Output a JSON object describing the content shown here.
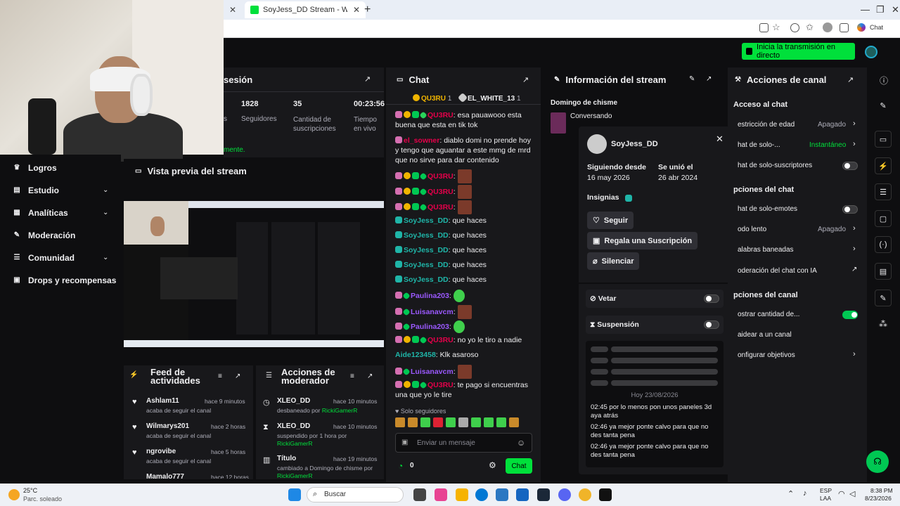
{
  "browser": {
    "tab1_label": "SoyJess_DD Stream - Watch Live o",
    "chat_label": "Chat"
  },
  "header": {
    "go_live": "Inicia la transmisión en directo"
  },
  "session": {
    "title": "sesión",
    "stats": [
      {
        "value": "",
        "label": "s"
      },
      {
        "value": "1828",
        "label": "Seguidores"
      },
      {
        "value": "35",
        "label": "Cantidad de suscripciones"
      },
      {
        "value": "00:23:56",
        "label": "Tiempo en vivo"
      }
    ],
    "footer": "mente."
  },
  "nav": {
    "items": [
      {
        "label": "Logros"
      },
      {
        "label": "Estudio"
      },
      {
        "label": "Analíticas"
      },
      {
        "label": "Moderación"
      },
      {
        "label": "Comunidad"
      },
      {
        "label": "Drops y recompensas"
      }
    ]
  },
  "preview": {
    "title": "Vista previa del stream"
  },
  "feed": {
    "title": "Feed de actividades",
    "items": [
      {
        "name": "Ashlam11",
        "time": "hace 9 minutos",
        "desc": "acaba de seguir el canal"
      },
      {
        "name": "Wilmarys201",
        "time": "hace 2 horas",
        "desc": "acaba de seguir el canal"
      },
      {
        "name": "ngrovibe",
        "time": "hace 5 horas",
        "desc": "acaba de seguir el canal"
      },
      {
        "name": "Mamalo777",
        "time": "hace 12 horas",
        "desc": ""
      }
    ]
  },
  "mod": {
    "title": "Acciones de moderador",
    "items": [
      {
        "name": "XLEO_DD",
        "time": "hace 10 minutos",
        "desc": "desbaneado por",
        "by": "RickiGamerR"
      },
      {
        "name": "XLEO_DD",
        "time": "hace 10 minutos",
        "desc": "suspendido por 1 hora por",
        "by": "RickiGamerR"
      },
      {
        "name": "Título",
        "time": "hace 19 minutos",
        "desc": "cambiado a Domingo de chisme por",
        "by": "RickiGamerR"
      }
    ]
  },
  "chat": {
    "title": "Chat",
    "leaders": [
      {
        "name": "QU3RU",
        "count": "1"
      },
      {
        "name": "EL_WHITE_13",
        "count": "1"
      }
    ],
    "messages": [
      {
        "user": "QU3RU",
        "text": ": esa pauawooo esta buena que esta en tik tok"
      },
      {
        "user": "el_sowner",
        "text": ": diablo domi no prende hoy y tengo que aguantar a este mmg de mrd que no sirve para dar contenido"
      },
      {
        "user": "QU3RU",
        "text": ":"
      },
      {
        "user": "QU3RU",
        "text": ":"
      },
      {
        "user": "QU3RU",
        "text": ":"
      },
      {
        "user": "SoyJess_DD",
        "text": ": que haces"
      },
      {
        "user": "SoyJess_DD",
        "text": ": que haces"
      },
      {
        "user": "SoyJess_DD",
        "text": ": que haces"
      },
      {
        "user": "SoyJess_DD",
        "text": ": que haces"
      },
      {
        "user": "SoyJess_DD",
        "text": ": que haces"
      },
      {
        "user": "Paulina203",
        "text": ":"
      },
      {
        "user": "Luisanavcm",
        "text": ":"
      },
      {
        "user": "Paulina203",
        "text": ":"
      },
      {
        "user": "QU3RU",
        "text": ": no yo le tiro a nadie"
      },
      {
        "user": "Aide123458",
        "text": ": Klk asaroso"
      },
      {
        "user": "Luisanavcm",
        "text": ":"
      },
      {
        "user": "QU3RU",
        "text": ": te pago si encuentras una que yo le tire"
      }
    ],
    "followers_only": "Solo seguidores",
    "placeholder": "Enviar un mensaje",
    "points": "0",
    "send": "Chat"
  },
  "info": {
    "title": "Información del stream",
    "stream_title": "Domingo de chisme",
    "category": "Conversando"
  },
  "usercard": {
    "username": "SoyJess_DD",
    "following_label": "Siguiendo desde",
    "following_date": "16 may 2026",
    "joined_label": "Se unió el",
    "joined_date": "26 abr 2024",
    "badges_label": "Insignias",
    "follow": "Seguir",
    "gift": "Regala una Suscripción",
    "mute": "Silenciar",
    "ban": "Vetar",
    "timeout": "Suspensión",
    "date_sep": "Hoy 23/08/2026",
    "history": [
      {
        "time": "02:45",
        "text": "por lo menos pon unos paneles 3d aya atrás"
      },
      {
        "time": "02:46",
        "text": "ya mejor ponte calvo para que no des tanta pena"
      },
      {
        "time": "02:46",
        "text": "ya mejor ponte calvo para que no des tanta pena"
      }
    ]
  },
  "actions": {
    "title": "Acciones de canal",
    "access": "Acceso al chat",
    "rows1": [
      {
        "label": "estricción de edad",
        "value": "Apagado"
      },
      {
        "label": "hat de solo-...",
        "value": "Instantáneo"
      },
      {
        "label": "hat de solo-suscriptores",
        "value": ""
      }
    ],
    "chat_opts": "pciones del chat",
    "rows2": [
      {
        "label": "hat de solo-emotes",
        "value": ""
      },
      {
        "label": "odo lento",
        "value": "Apagado"
      },
      {
        "label": "alabras baneadas",
        "value": ""
      },
      {
        "label": "oderación del chat con IA",
        "value": ""
      }
    ],
    "channel_opts": "pciones del canal",
    "rows3": [
      {
        "label": "ostrar cantidad de...",
        "value": ""
      },
      {
        "label": "aidear a un canal",
        "value": ""
      },
      {
        "label": "onfigurar objetivos",
        "value": ""
      }
    ]
  },
  "taskbar": {
    "temp": "25°C",
    "weather": "Parc. soleado",
    "search": "Buscar",
    "lang1": "ESP",
    "lang2": "LAA",
    "time": "8:38 PM",
    "date": "8/23/2026"
  }
}
